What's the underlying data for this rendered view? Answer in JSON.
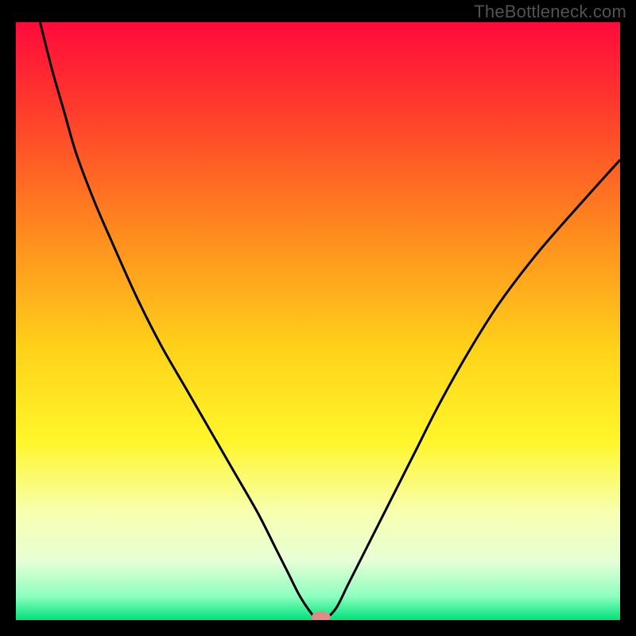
{
  "watermark": "TheBottleneck.com",
  "chart_data": {
    "type": "line",
    "title": "",
    "xlabel": "",
    "ylabel": "",
    "xlim": [
      0,
      100
    ],
    "ylim": [
      0,
      100
    ],
    "grid": false,
    "legend": false,
    "gradient_stops": [
      {
        "offset": 0,
        "color": "#ff0b3c"
      },
      {
        "offset": 15,
        "color": "#ff3d2b"
      },
      {
        "offset": 35,
        "color": "#ff8a1e"
      },
      {
        "offset": 55,
        "color": "#ffd31a"
      },
      {
        "offset": 70,
        "color": "#fff62a"
      },
      {
        "offset": 82,
        "color": "#f8ffb0"
      },
      {
        "offset": 90,
        "color": "#e7ffd6"
      },
      {
        "offset": 96,
        "color": "#8dffbf"
      },
      {
        "offset": 100,
        "color": "#00e27a"
      }
    ],
    "series": [
      {
        "name": "bottleneck-curve",
        "x": [
          4,
          6,
          8,
          10,
          13,
          16,
          20,
          24,
          28,
          32,
          36,
          40,
          43,
          45,
          47,
          49,
          50,
          51,
          53,
          55,
          58,
          62,
          66,
          70,
          75,
          80,
          86,
          92,
          100
        ],
        "y": [
          100,
          92,
          85,
          78,
          70,
          63,
          54,
          46,
          39,
          32,
          25,
          18,
          12,
          8,
          4,
          1,
          0,
          0,
          2,
          6,
          12,
          20,
          28,
          36,
          45,
          53,
          61,
          68,
          77
        ]
      }
    ],
    "marker": {
      "x": 50.5,
      "y": 0.5,
      "color": "#e08b86",
      "rx": 12,
      "ry": 7
    }
  }
}
